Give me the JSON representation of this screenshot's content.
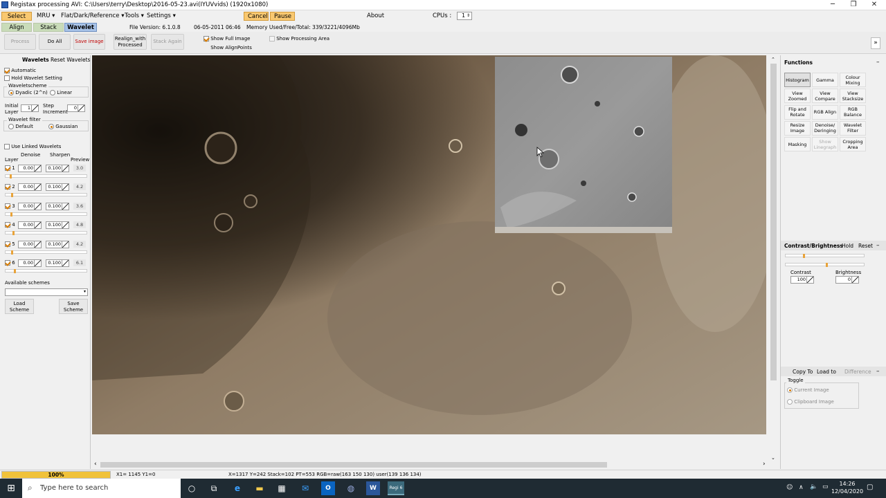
{
  "window": {
    "title": "Registax processing AVI: C:\\Users\\terry\\Desktop\\2016-05-23.avi(IYUVvids) (1920x1080)",
    "minimize": "─",
    "maximize": "❐",
    "close": "✕"
  },
  "menu": {
    "select": "Select",
    "mru": "MRU ▾",
    "flat": "Flat/Dark/Reference ▾",
    "tools": "Tools ▾",
    "settings": "Settings ▾",
    "cancel": "Cancel",
    "pause": "Pause",
    "about": "About",
    "cpus_label": "CPUs :",
    "cpus_value": "1"
  },
  "tabs": {
    "align": "Align",
    "stack": "Stack",
    "wavelet": "Wavelet"
  },
  "info": {
    "file_version": "File Version: 6.1.0.8",
    "date": "06-05-2011 06:46",
    "memory": "Memory Used/Free/Total: 339/3221/4096Mb"
  },
  "toolbar": {
    "process": "Process",
    "do_all": "Do All",
    "save_image": "Save image",
    "realign": "Realign_with Processed",
    "stack_again": "Stack Again",
    "show_full_image": "Show Full Image",
    "show_alignpoints": "Show AlignPoints",
    "show_processing_area": "Show Processing Area",
    "collapse": "»"
  },
  "wavelets": {
    "header": "Wavelets",
    "reset": "Reset Wavelets",
    "automatic": "Automatic",
    "hold": "Hold Wavelet Setting",
    "scheme_group": "Waveletscheme",
    "dyadic": "Dyadic (2^n)",
    "linear": "Linear",
    "initial_layer_label": "Initial Layer",
    "initial_layer_value": "1",
    "step_increment_label": "Step Increment",
    "step_increment_value": "0",
    "filter_group": "Wavelet filter",
    "default": "Default",
    "gaussian": "Gaussian",
    "use_linked": "Use Linked Wavelets",
    "col_denoise": "Denoise",
    "col_sharpen": "Sharpen",
    "col_layer": "Layer",
    "col_preview": "Preview",
    "layers": [
      {
        "num": "1",
        "denoise": "0.00",
        "sharpen": "0.100",
        "preview": "3.0",
        "level": 0.05
      },
      {
        "num": "2",
        "denoise": "0.00",
        "sharpen": "0.100",
        "preview": "4.2",
        "level": 0.07
      },
      {
        "num": "3",
        "denoise": "0.00",
        "sharpen": "0.100",
        "preview": "3.6",
        "level": 0.06
      },
      {
        "num": "4",
        "denoise": "0.00",
        "sharpen": "0.100",
        "preview": "4.8",
        "level": 0.08
      },
      {
        "num": "5",
        "denoise": "0.00",
        "sharpen": "0.100",
        "preview": "4.2",
        "level": 0.07
      },
      {
        "num": "6",
        "denoise": "0.00",
        "sharpen": "0.100",
        "preview": "6.1",
        "level": 0.1
      }
    ],
    "available_schemes": "Available schemes",
    "load_scheme": "Load Scheme",
    "save_scheme": "Save Scheme"
  },
  "functions": {
    "header": "Functions",
    "collapse": "–",
    "buttons": [
      [
        "Histogram",
        "Gamma",
        "Colour Mixing"
      ],
      [
        "View Zoomed",
        "View Compare",
        "View Stacksize"
      ],
      [
        "Flip and Rotate",
        "RGB Align",
        "RGB Balance"
      ],
      [
        "Resize Image",
        "Denoise/ Deringing",
        "Wavelet Filter"
      ],
      [
        "Masking",
        "Show Linegraph",
        "Cropping Area"
      ]
    ]
  },
  "contrast": {
    "header": "Contrast/Brightness",
    "hold": "Hold",
    "reset": "Reset",
    "collapse": "–",
    "contrast_label": "Contrast",
    "contrast_value": "100",
    "brightness_label": "Brightness",
    "brightness_value": "0",
    "contrast_level": 0.22,
    "brightness_level": 0.5
  },
  "copyto": {
    "copy_to": "Copy To",
    "load_to": "Load to",
    "difference": "Difference",
    "collapse": "–",
    "toggle": "Toggle",
    "current_image": "Current Image",
    "clipboard_image": "Clipboard Image"
  },
  "status": {
    "progress": "100%",
    "progress_value": 1.0,
    "xy": "X1= 1145 Y1=0",
    "pixel": "X=1317 Y=242 Stack=102 PT=553 RGB=raw(163 150 130) user(139 136 134)"
  },
  "taskbar": {
    "search_placeholder": "Type here to search",
    "time": "14:26",
    "date": "12/04/2020",
    "app_badge": "Regi 6"
  },
  "colors": {
    "accent_orange": "#f9c870",
    "wavelet_tab": "#a8c3e8",
    "align_tab": "#c9dcb9",
    "progress": "#f0c23a"
  }
}
